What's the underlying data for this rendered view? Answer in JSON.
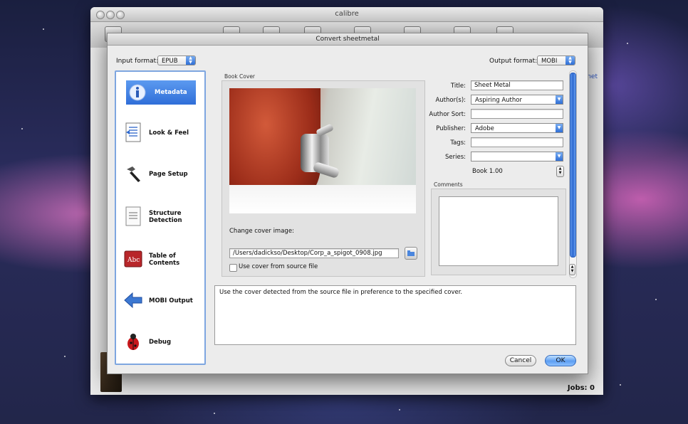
{
  "app": {
    "title": "calibre",
    "side_link": "net",
    "jobs_label": "Jobs: 0"
  },
  "dialog": {
    "title": "Convert sheetmetal",
    "input_format_label": "Input format:",
    "input_format_value": "EPUB",
    "output_format_label": "Output format:",
    "output_format_value": "MOBI"
  },
  "sidebar": {
    "items": [
      {
        "label": "Metadata",
        "icon": "info-icon"
      },
      {
        "label": "Look & Feel",
        "icon": "document-icon"
      },
      {
        "label": "Page Setup",
        "icon": "hammer-icon"
      },
      {
        "label": "Structure Detection",
        "icon": "structure-icon"
      },
      {
        "label": "Table of Contents",
        "icon": "toc-book-icon"
      },
      {
        "label": "MOBI Output",
        "icon": "arrow-left-icon"
      },
      {
        "label": "Debug",
        "icon": "bug-icon"
      }
    ]
  },
  "cover": {
    "group_label": "Book Cover",
    "change_label": "Change cover image:",
    "path_value": "/Users/dadickso/Desktop/Corp_a_spigot_0908.jpg",
    "use_source_label": "Use cover from source file"
  },
  "metadata": {
    "title_label": "Title:",
    "title_value": "Sheet Metal",
    "author_label": "Author(s):",
    "author_value": "Aspiring Author",
    "author_sort_label": "Author Sort:",
    "author_sort_value": "",
    "publisher_label": "Publisher:",
    "publisher_value": "Adobe",
    "tags_label": "Tags:",
    "tags_value": "",
    "series_label": "Series:",
    "series_value": "",
    "series_index_value": "Book 1.00",
    "comments_label": "Comments",
    "comments_value": ""
  },
  "help_text": "Use the cover detected from the source file in preference to the specified cover.",
  "buttons": {
    "cancel": "Cancel",
    "ok": "OK"
  }
}
